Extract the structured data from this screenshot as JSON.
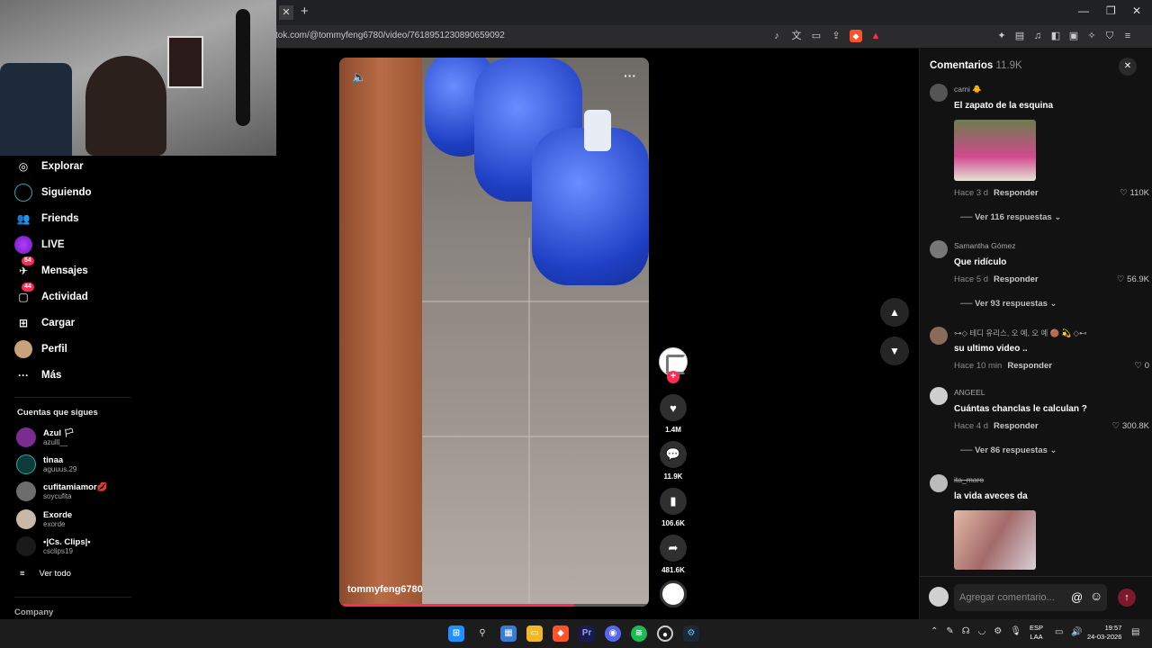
{
  "browser": {
    "url": "tok.com/@tommyfeng6780/video/7618951230890659092",
    "tab_close": "✕",
    "new_tab": "+"
  },
  "sidebar": {
    "items": [
      {
        "label": "Explorar",
        "icon": "compass-icon"
      },
      {
        "label": "Siguiendo",
        "icon": "following-icon"
      },
      {
        "label": "Friends",
        "icon": "friends-icon"
      },
      {
        "label": "LIVE",
        "icon": "live-icon"
      },
      {
        "label": "Mensajes",
        "icon": "messages-icon",
        "badge": "54"
      },
      {
        "label": "Actividad",
        "icon": "activity-icon",
        "badge": "44"
      },
      {
        "label": "Cargar",
        "icon": "upload-icon"
      },
      {
        "label": "Perfil",
        "icon": "profile-icon"
      },
      {
        "label": "Más",
        "icon": "more-icon"
      }
    ],
    "following_heading": "Cuentas que sigues",
    "following": [
      {
        "name": "Azul 🏳",
        "handle": "azulll__",
        "color": "#7b2c8f"
      },
      {
        "name": "tinaa",
        "handle": "aguuus.29",
        "color": "#0e3a3a"
      },
      {
        "name": "cufitamiamor💋",
        "handle": "soycufita",
        "color": "#6d6d6d"
      },
      {
        "name": "Exorde",
        "handle": "exorde",
        "color": "#c9b8a8"
      },
      {
        "name": "•|Cs. Clips|•",
        "handle": "csclips19",
        "color": "#1a1a1a"
      }
    ],
    "see_all": "Ver todo",
    "company": "Company"
  },
  "video": {
    "username": "tommyfeng6780",
    "progress": 0.76
  },
  "rail": {
    "likes": "1.4M",
    "comments": "11.9K",
    "saves": "106.6K",
    "shares": "481.6K"
  },
  "comments_panel": {
    "title": "Comentarios",
    "count": "11.9K",
    "input_placeholder": "Agregar comentario...",
    "reply_label": "Responder",
    "items": [
      {
        "user": "cami 🐥",
        "text": "El zapato de la esquina",
        "time": "Hace 3 d",
        "likes": "110K",
        "replies": "Ver 116 respuestas"
      },
      {
        "user": "Samantha Gómez",
        "text": "Que ridículo",
        "time": "Hace 5 d",
        "likes": "56.9K",
        "replies": "Ver 93 respuestas"
      },
      {
        "user": "⊶◇ 테디 유리스, 오 예, 오 예 🟤 💫 ◇⊷",
        "text": "su ultimo video ..",
        "time": "Hace 10 min",
        "likes": "0",
        "replies": ""
      },
      {
        "user": "ANGEEL",
        "text": "Cuántas chanclas le calculan ?",
        "time": "Hace 4 d",
        "likes": "300.8K",
        "replies": "Ver 86 respuestas"
      },
      {
        "user": "ita_maro",
        "text": "la vida aveces da",
        "time": "",
        "likes": "",
        "replies": ""
      }
    ]
  },
  "taskbar": {
    "lang1": "ESP",
    "lang2": "LAA",
    "time": "19:57",
    "date": "24-03-2026"
  }
}
